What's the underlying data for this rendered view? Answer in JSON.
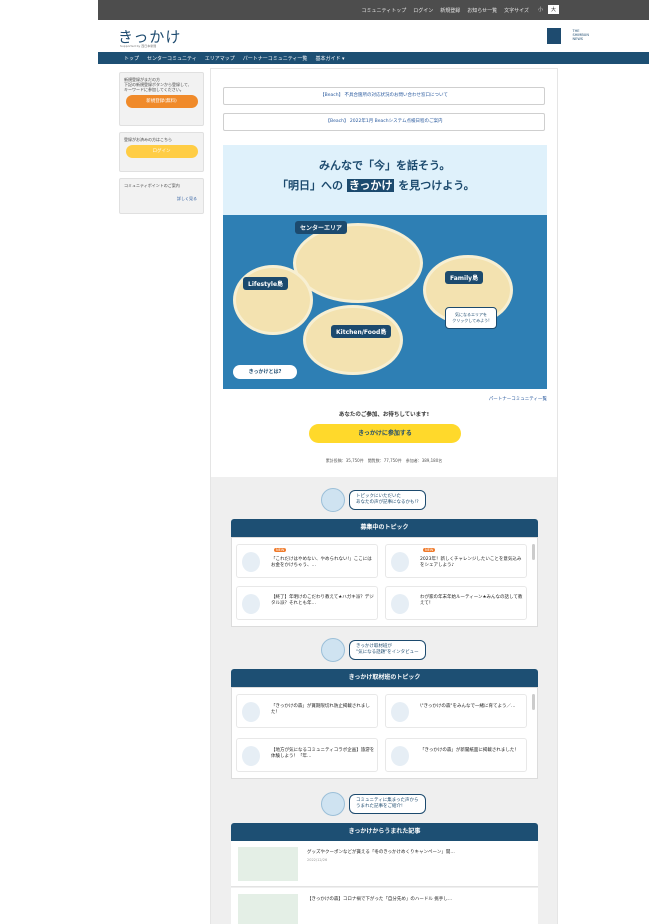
{
  "topbar": {
    "links": [
      "コミュニティトップ",
      "ログイン",
      "新規登録",
      "お知らせ一覧",
      "文字サイズ"
    ],
    "font_sizes": [
      "小",
      "大"
    ]
  },
  "header": {
    "logo": "きっかけ",
    "logo_sub": "Supported by 西日本新聞",
    "news_logo_text": "THE\nSHIMBUN\nNEWS"
  },
  "nav": {
    "items": [
      "トップ",
      "センターコミュニティ",
      "エリアマップ",
      "パートナーコミュニティ一覧",
      "基本ガイド ▾"
    ]
  },
  "sidebar": {
    "register_text": "新規登録がまだの方\n下記の新規登録ボタンから登録して、\nキーワードに参加してください。",
    "register_btn": "新規登録(無料)",
    "login_text": "登録がお済みの方はこちら",
    "login_btn": "ログイン",
    "points_title": "コミュニティポイントのご案内",
    "points_link": "詳しく見る"
  },
  "notices": [
    "【Beach】 不具合箇所の対応状況のお問い合わせ窓口について",
    "【Beach】 2022年1月 Beachシステム点検日程のご案内"
  ],
  "hero": {
    "line1": "みんなで「今」を話そう。",
    "line2_pre": "「明日」への",
    "line2_hl": "きっかけ",
    "line2_post": "を見つけよう。",
    "center": "センターエリア",
    "lifestyle": "Lifestyle島",
    "family": "Family島",
    "kitchen": "Kitchen/Food島",
    "bubble": "気になるエリアを\nクリックしてみよう!",
    "about_btn": "きっかけとは?"
  },
  "partner_link": "パートナーコミュニティ一覧",
  "thanks": "あなたのご参加、お待ちしています!",
  "join_btn": "きっかけに参加する",
  "stats": "累計投稿：35,750件　閲覧数：77,750件　参加者：389,180名",
  "sections": {
    "s1_intro": "トピックにいただいた\nあなたの声が記事になるかも!?",
    "s1_head": "募集中のトピック",
    "s1_cards": [
      {
        "new": "NEW",
        "text": "「これだけはやめない、やめられない!」ここにはお金をかけちゃう、…"
      },
      {
        "new": "NEW",
        "text": "2023年！新しくチャレンジしたいことを意気込みをシェアしよう♪"
      },
      {
        "new": "",
        "text": "【終了】年明けのこだわり教えて★ハガキ派？デジタル派？それとも年…"
      },
      {
        "new": "",
        "text": "わが家の年末年始ルーティーン★みんなの話して教えて！"
      }
    ],
    "s2_intro": "きっかけ取材班が\n\"気になる話題\"をインタビュー",
    "s2_head": "きっかけ取材班のトピック",
    "s2_cards": [
      {
        "text": "「きっかけの森」が賞期限切れ防止掲載されました！"
      },
      {
        "text": "\\\"きっかけの森\"をみんなで一緒に育てよう／…"
      },
      {
        "text": "【地方が気になるコミュニティコラボ企画】旅游を体験しよう！「年…"
      },
      {
        "text": "「きっかけの森」が新聞紙面に掲載されました！"
      }
    ],
    "s3_intro": "コミュニティに集まった声から\nうまれた記事をご紹介!",
    "s3_head": "きっかけからうまれた記事",
    "articles": [
      {
        "title": "グッズやクーポンなどが貰える「冬のきっかけめくりキャンペーン」開…",
        "date": "2022/12/26"
      },
      {
        "title": "【きっかけの森】コロナ禍で下がった「自分先め」のハードル 挑手し…",
        "date": ""
      }
    ]
  }
}
